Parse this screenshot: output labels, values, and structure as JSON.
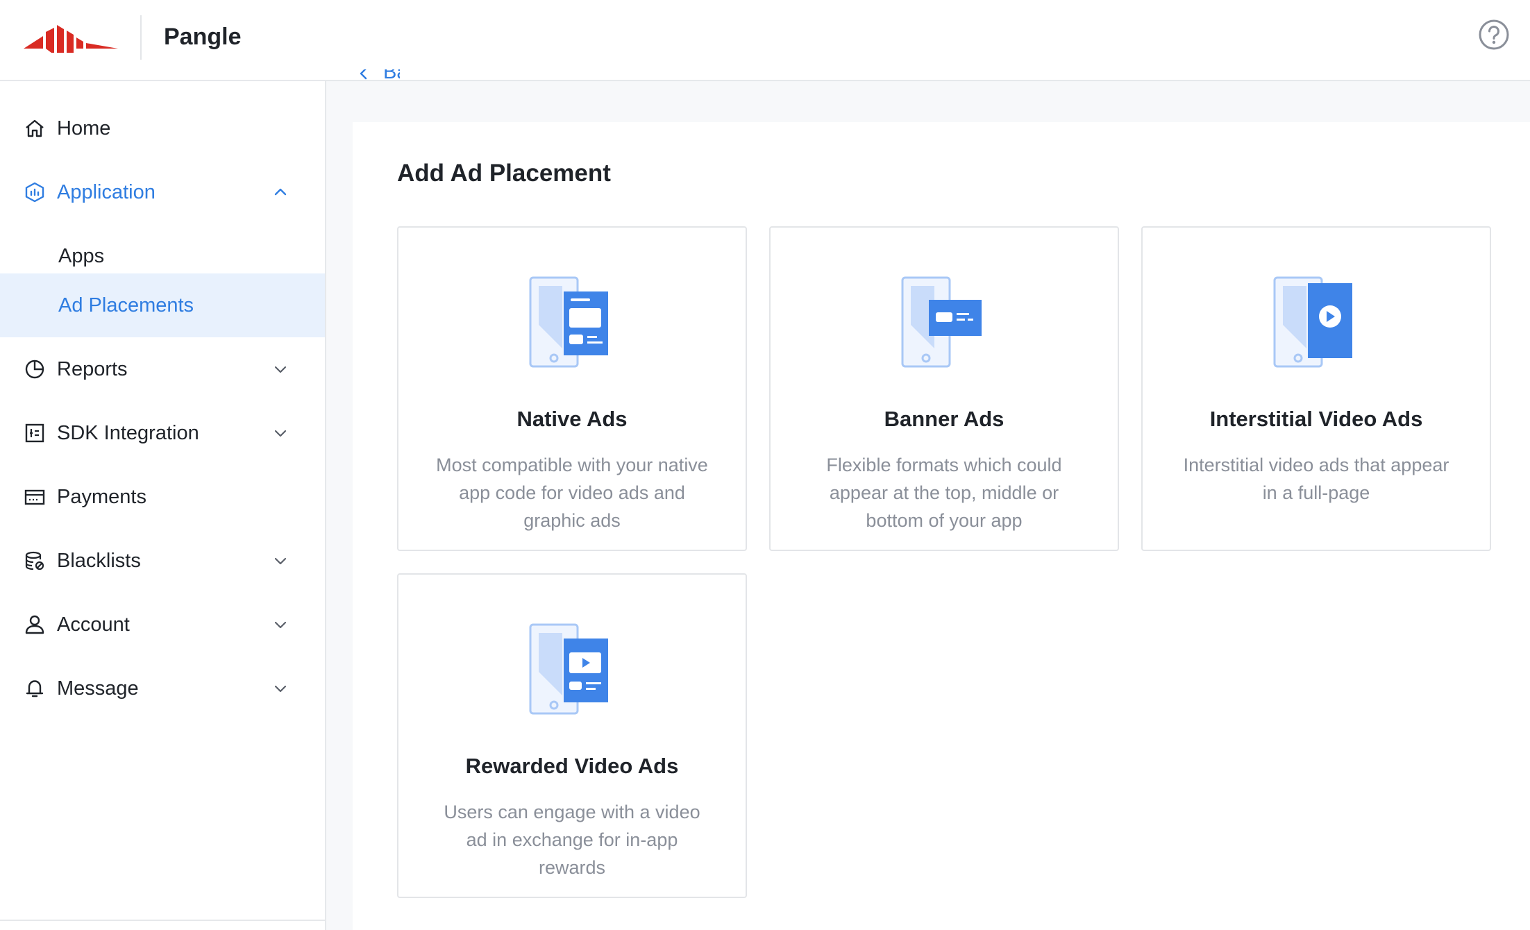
{
  "app": {
    "brand": "Pangle",
    "logo_color": "#d92b23",
    "accent": "#2f7de1"
  },
  "header": {
    "help_icon": "question-circle-icon"
  },
  "sidebar": {
    "items": [
      {
        "key": "home",
        "label": "Home",
        "icon": "home-icon",
        "expandable": false
      },
      {
        "key": "application",
        "label": "Application",
        "icon": "application-icon",
        "expandable": true,
        "open": true,
        "children": [
          {
            "key": "apps",
            "label": "Apps",
            "active": false
          },
          {
            "key": "ad-placements",
            "label": "Ad Placements",
            "active": true
          }
        ]
      },
      {
        "key": "reports",
        "label": "Reports",
        "icon": "pie-chart-icon",
        "expandable": true
      },
      {
        "key": "sdk",
        "label": "SDK Integration",
        "icon": "sdk-icon",
        "expandable": true
      },
      {
        "key": "payments",
        "label": "Payments",
        "icon": "wallet-icon",
        "expandable": false
      },
      {
        "key": "blacklists",
        "label": "Blacklists",
        "icon": "database-icon",
        "expandable": true
      },
      {
        "key": "account",
        "label": "Account",
        "icon": "user-icon",
        "expandable": true
      },
      {
        "key": "message",
        "label": "Message",
        "icon": "bell-icon",
        "expandable": true
      }
    ]
  },
  "main": {
    "back_label": "Back",
    "title": "Add Ad Placement",
    "cards": [
      {
        "key": "native",
        "title": "Native Ads",
        "description": "Most compatible with your native app code for video ads and graphic ads",
        "icon": "native-ad-illustration"
      },
      {
        "key": "banner",
        "title": "Banner Ads",
        "description": "Flexible formats which could appear at the top, middle or bottom of your app",
        "icon": "banner-ad-illustration"
      },
      {
        "key": "interstitial",
        "title": "Interstitial Video Ads",
        "description": "Interstitial video ads that appear in a full-page",
        "icon": "interstitial-ad-illustration"
      },
      {
        "key": "rewarded",
        "title": "Rewarded Video Ads",
        "description": "Users can engage with a video ad in exchange for in-app rewards",
        "icon": "rewarded-ad-illustration"
      }
    ]
  }
}
